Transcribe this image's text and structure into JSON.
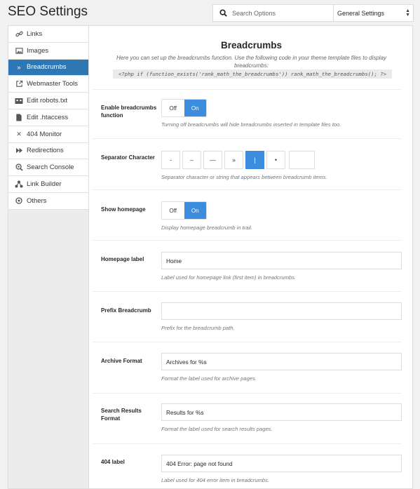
{
  "header": {
    "title": "SEO Settings",
    "search_placeholder": "Search Options",
    "settings_select": "General Settings"
  },
  "sidebar": {
    "items": [
      {
        "label": "Links",
        "icon": "link-icon"
      },
      {
        "label": "Images",
        "icon": "image-icon"
      },
      {
        "label": "Breadcrumbs",
        "icon": "chevron-right-icon",
        "active": true
      },
      {
        "label": "Webmaster Tools",
        "icon": "external-link-icon"
      },
      {
        "label": "Edit robots.txt",
        "icon": "robot-icon"
      },
      {
        "label": "Edit .htaccess",
        "icon": "file-icon"
      },
      {
        "label": "404 Monitor",
        "icon": "close-icon"
      },
      {
        "label": "Redirections",
        "icon": "fast-forward-icon"
      },
      {
        "label": "Search Console",
        "icon": "search-console-icon"
      },
      {
        "label": "Link Builder",
        "icon": "link-builder-icon"
      },
      {
        "label": "Others",
        "icon": "circle-icon"
      }
    ]
  },
  "section": {
    "title": "Breadcrumbs",
    "description": "Here you can set up the breadcrumbs function. Use the following code in your theme template files to display breadcrumbs:",
    "code": "<?php if (function_exists('rank_math_the_breadcrumbs')) rank_math_the_breadcrumbs(); ?>"
  },
  "fields": {
    "enable": {
      "label": "Enable breadcrumbs function",
      "off": "Off",
      "on": "On",
      "value": "On",
      "help": "Turning off breadcrumbs will hide breadcrumbs inserted in template files too."
    },
    "separator": {
      "label": "Separator Character",
      "options": [
        "-",
        "–",
        "—",
        "»",
        "|",
        "•"
      ],
      "selected": "|",
      "help": "Separator character or string that appears between breadcrumb items."
    },
    "show_homepage": {
      "label": "Show homepage",
      "off": "Off",
      "on": "On",
      "value": "On",
      "help": "Display homepage breadcrumb in trail."
    },
    "homepage_label": {
      "label": "Homepage label",
      "value": "Home",
      "help": "Label used for homepage link (first item) in breadcrumbs."
    },
    "prefix": {
      "label": "Prefix Breadcrumb",
      "value": "",
      "help": "Prefix for the breadcrumb path."
    },
    "archive": {
      "label": "Archive Format",
      "value": "Archives for %s",
      "help": "Format the label used for archive pages."
    },
    "search_results": {
      "label": "Search Results Format",
      "value": "Results for %s",
      "help": "Format the label used for search results pages."
    },
    "label_404": {
      "label": "404 label",
      "value": "404 Error: page not found",
      "help": "Label used for 404 error item in breadcrumbs."
    }
  },
  "colors": {
    "accent": "#3c8ddd",
    "sidebar_active": "#2e77b5"
  }
}
